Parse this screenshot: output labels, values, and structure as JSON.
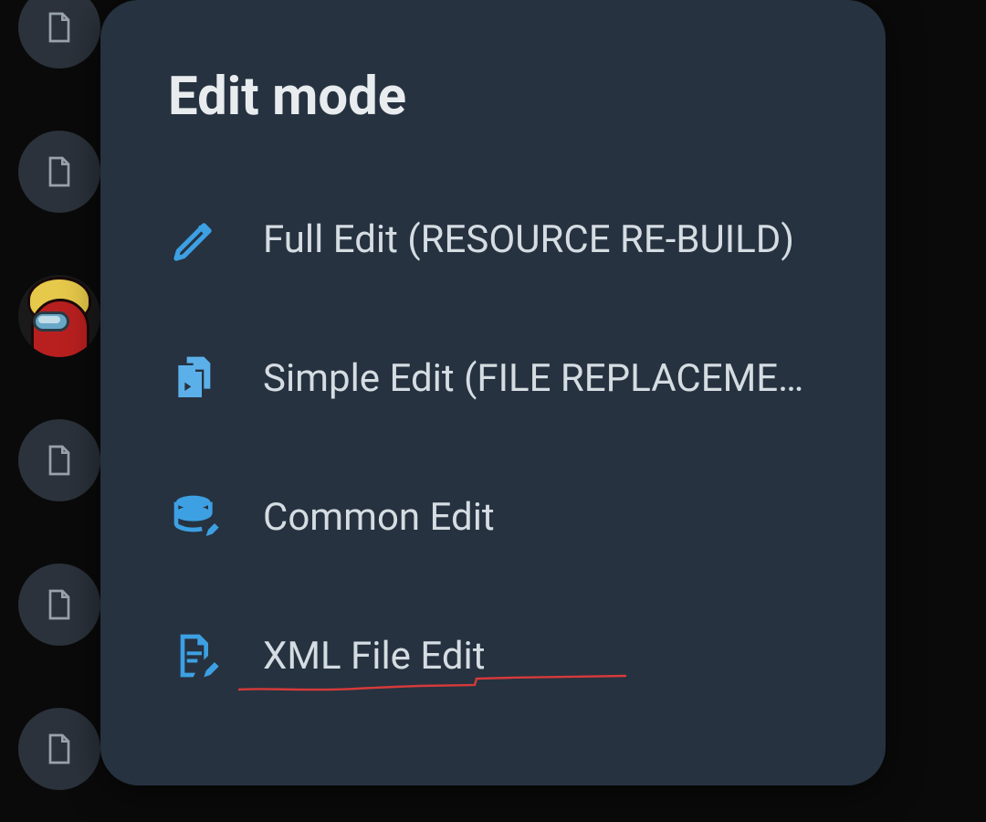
{
  "dialog": {
    "title": "Edit mode",
    "items": [
      {
        "label": "Full Edit (RESOURCE RE-BUILD)",
        "icon": "pencil-icon"
      },
      {
        "label": "Simple Edit (FILE REPLACEME…",
        "icon": "file-copy-icon"
      },
      {
        "label": "Common Edit",
        "icon": "database-edit-icon"
      },
      {
        "label": "XML File Edit",
        "icon": "file-edit-icon"
      }
    ]
  },
  "colors": {
    "accent": "#3da0e3",
    "dialog_bg": "#263240",
    "text": "#d5dce2",
    "annotation": "#d63a3a"
  }
}
